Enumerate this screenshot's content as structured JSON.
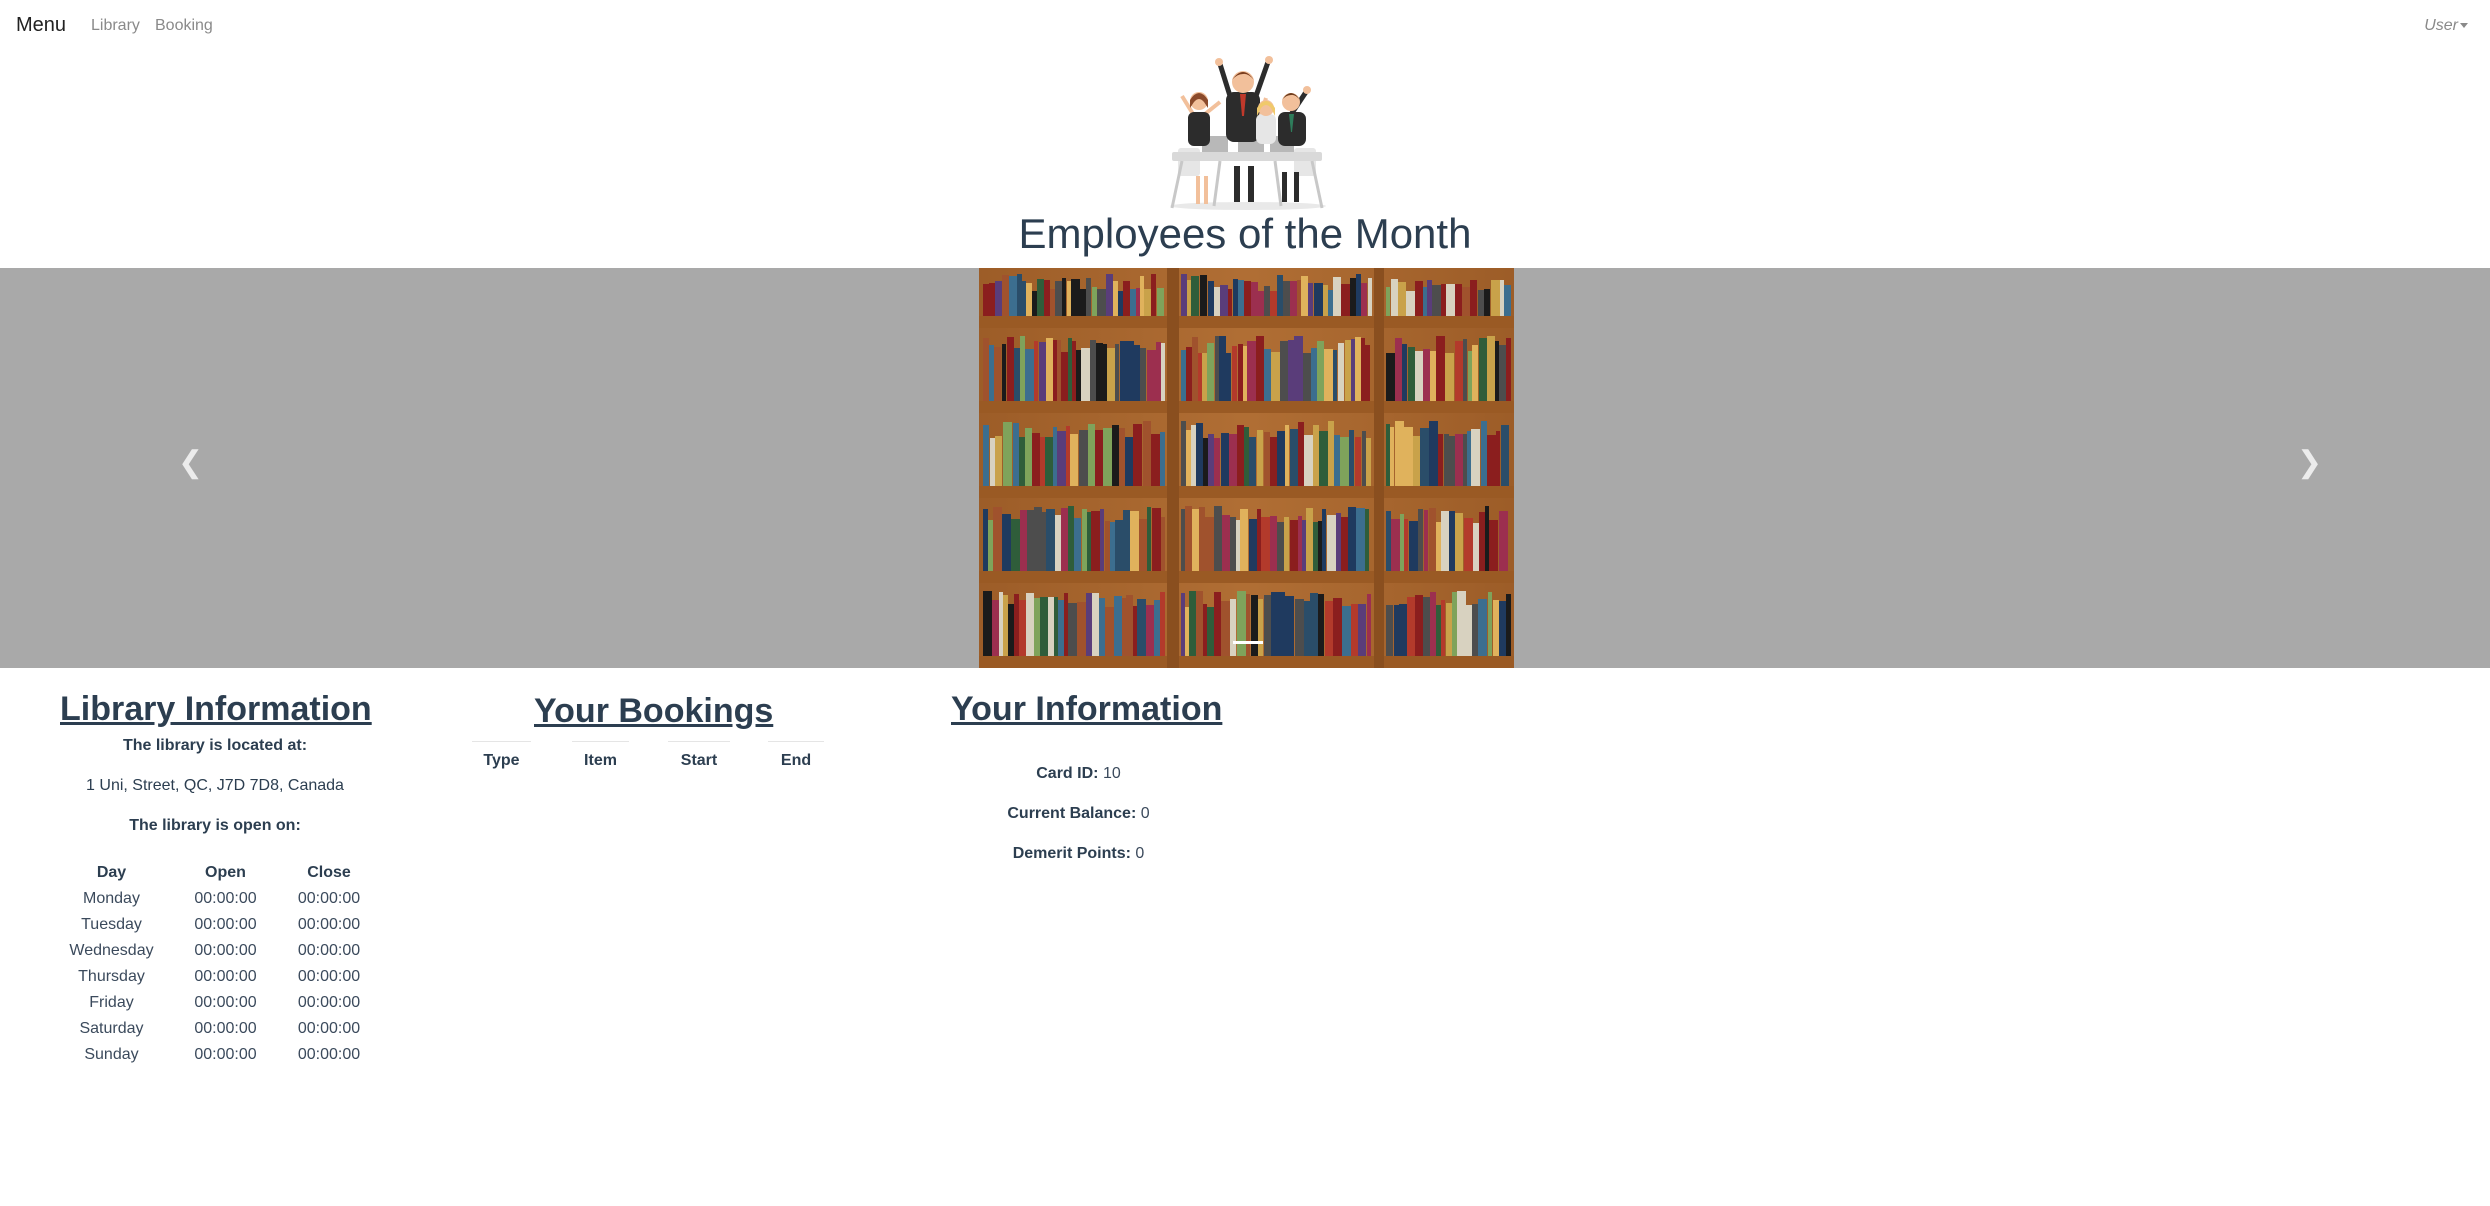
{
  "navbar": {
    "brand": "Menu",
    "links": [
      "Library",
      "Booking"
    ],
    "user": "User"
  },
  "header": {
    "title": "Employees of the Month",
    "image": "celebrating-employees-illustration"
  },
  "carousel": {
    "slide_image": "library-bookshelves-photo",
    "prev_icon": "chevron-left-icon",
    "next_icon": "chevron-right-icon",
    "prev_glyph": "❮",
    "next_glyph": "❯"
  },
  "library_info": {
    "title": "Library Information",
    "located_label": "The library is located at:",
    "address": "1 Uni, Street, QC, J7D 7D8, Canada",
    "open_label": "The library is open on:",
    "columns": [
      "Day",
      "Open",
      "Close"
    ],
    "hours": [
      {
        "day": "Monday",
        "open": "00:00:00",
        "close": "00:00:00"
      },
      {
        "day": "Tuesday",
        "open": "00:00:00",
        "close": "00:00:00"
      },
      {
        "day": "Wednesday",
        "open": "00:00:00",
        "close": "00:00:00"
      },
      {
        "day": "Thursday",
        "open": "00:00:00",
        "close": "00:00:00"
      },
      {
        "day": "Friday",
        "open": "00:00:00",
        "close": "00:00:00"
      },
      {
        "day": "Saturday",
        "open": "00:00:00",
        "close": "00:00:00"
      },
      {
        "day": "Sunday",
        "open": "00:00:00",
        "close": "00:00:00"
      }
    ]
  },
  "bookings": {
    "title": "Your Bookings",
    "columns": [
      "Type",
      "Item",
      "Start",
      "End"
    ]
  },
  "your_info": {
    "title": "Your Information",
    "card_id_label": "Card ID:",
    "card_id": "10",
    "balance_label": "Current Balance:",
    "balance": "0",
    "demerit_label": "Demerit Points:",
    "demerit": "0"
  }
}
